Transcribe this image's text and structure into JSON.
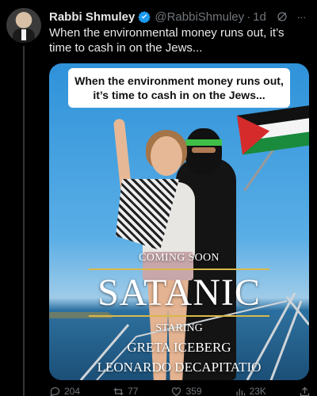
{
  "tweet": {
    "author_name": "Rabbi Shmuley",
    "handle": "@RabbiShmuley",
    "separator": "·",
    "time": "1d",
    "text": "When the environmental money runs out, it’s time to cash in on the Jews...",
    "more_glyph": "···"
  },
  "media": {
    "caption": "When the environment money runs out, it’s time to cash in on the Jews...",
    "poster": {
      "coming_soon": "COMING SOON",
      "title": "SATANIC",
      "staring": "STARING",
      "actor_1": "GRETA ICEBERG",
      "actor_2": "LEONARDO DECAPITATIO"
    }
  },
  "actions": {
    "replies": "204",
    "reposts": "77",
    "likes": "359",
    "views": "23K"
  },
  "icons": [
    "verified-badge-icon",
    "grok-icon",
    "more-icon",
    "reply-icon",
    "repost-icon",
    "like-icon",
    "views-icon",
    "share-icon"
  ],
  "colors": {
    "background": "#000000",
    "text": "#e7e9ea",
    "muted": "#71767b",
    "verified": "#1d9bf0"
  }
}
